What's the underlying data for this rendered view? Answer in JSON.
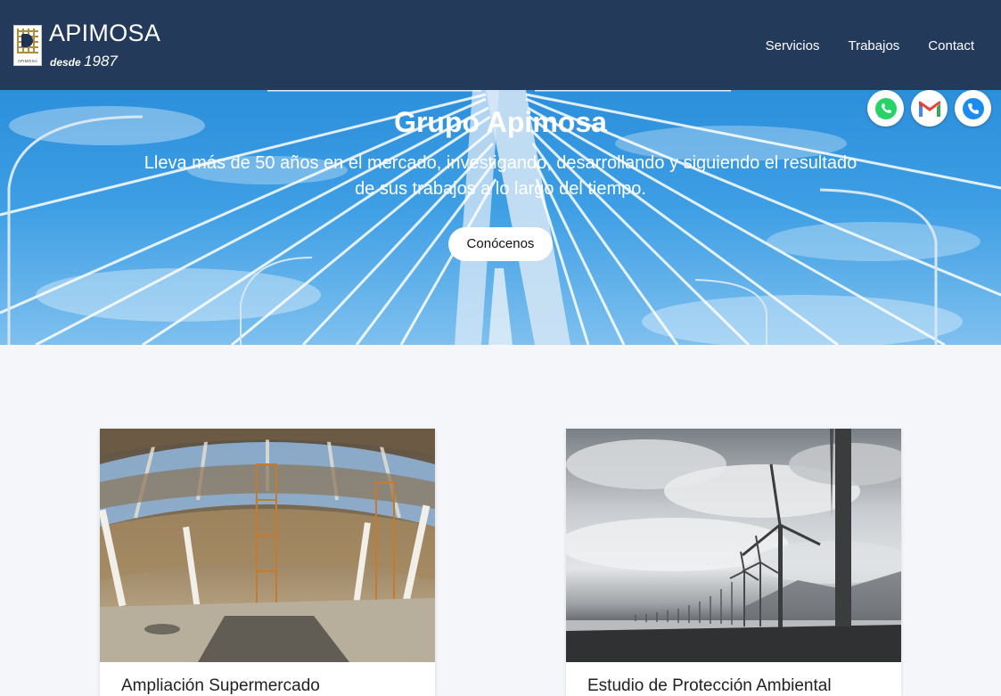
{
  "nav": {
    "brand": "APIMOSA",
    "tagline": "desde",
    "year": "1987",
    "logo_text": "APIMOSA",
    "items": [
      {
        "label": "Servicios"
      },
      {
        "label": "Trabajos"
      },
      {
        "label": "Contact"
      }
    ]
  },
  "hero": {
    "title": "Grupo Apimosa",
    "text": "Lleva más de 50 años en el mercado, investigando, desarrollando y siguiendo el resultado de sus trabajos a lo largo del tiempo.",
    "button": "Conócenos"
  },
  "social": [
    {
      "icon": "whatsapp-icon",
      "color": "#25d366"
    },
    {
      "icon": "gmail-icon",
      "color": "#ea4335"
    },
    {
      "icon": "phone-icon",
      "color": "#1a8cf0"
    }
  ],
  "cards": [
    {
      "caption": "Ampliación Supermercado",
      "image": "stadium-roof-construction-image"
    },
    {
      "caption": "Estudio de Protección Ambiental",
      "image": "wind-turbines-image"
    }
  ],
  "colors": {
    "navbar": "#233a5a",
    "page_bg": "#f4f6f9",
    "hero_sky": "#3d9ee4"
  }
}
